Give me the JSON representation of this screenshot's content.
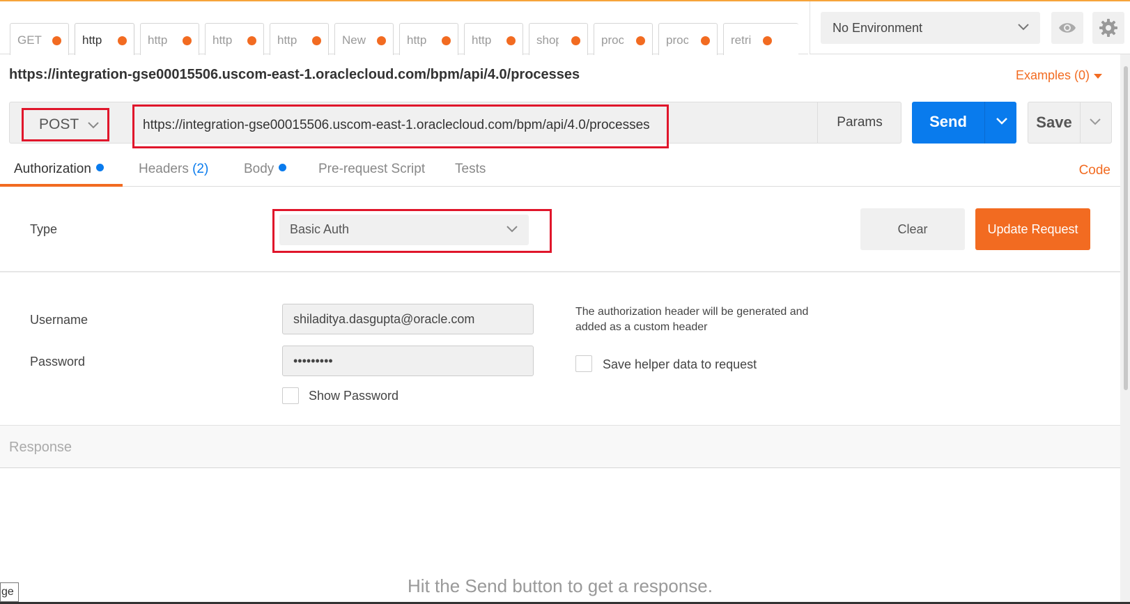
{
  "tabs": [
    {
      "label": "GET",
      "modified": true
    },
    {
      "label": "http",
      "modified": true,
      "active": true
    },
    {
      "label": "http",
      "modified": true
    },
    {
      "label": "http",
      "modified": true
    },
    {
      "label": "http",
      "modified": true
    },
    {
      "label": "New",
      "modified": true
    },
    {
      "label": "http",
      "modified": true
    },
    {
      "label": "http",
      "modified": true
    },
    {
      "label": "shop",
      "modified": true
    },
    {
      "label": "proc",
      "modified": true
    },
    {
      "label": "proc",
      "modified": true
    },
    {
      "label": "retri",
      "modified": true
    }
  ],
  "environment": {
    "selected": "No Environment"
  },
  "request": {
    "title": "https://integration-gse00015506.uscom-east-1.oraclecloud.com/bpm/api/4.0/processes",
    "examples_label": "Examples (0)",
    "method": "POST",
    "url": "https://integration-gse00015506.uscom-east-1.oraclecloud.com/bpm/api/4.0/processes",
    "params_label": "Params",
    "send_label": "Send",
    "save_label": "Save"
  },
  "subtabs": {
    "authorization": "Authorization",
    "headers": "Headers",
    "headers_count": "(2)",
    "body": "Body",
    "prerequest": "Pre-request Script",
    "tests": "Tests",
    "code": "Code"
  },
  "auth": {
    "type_label": "Type",
    "type_value": "Basic Auth",
    "clear_label": "Clear",
    "update_label": "Update Request",
    "username_label": "Username",
    "username_value": "shiladitya.dasgupta@oracle.com",
    "password_label": "Password",
    "password_value": "•••••••••",
    "show_password_label": "Show Password",
    "helper_text": "The authorization header will be generated and added as a custom header",
    "save_helper_label": "Save helper data to request"
  },
  "response": {
    "label": "Response",
    "hint": "Hit the Send button to get a response."
  },
  "tooltip": "ge",
  "colors": {
    "accent_orange": "#f26b21",
    "send_blue": "#097bed",
    "highlight_red": "#e0162b"
  }
}
